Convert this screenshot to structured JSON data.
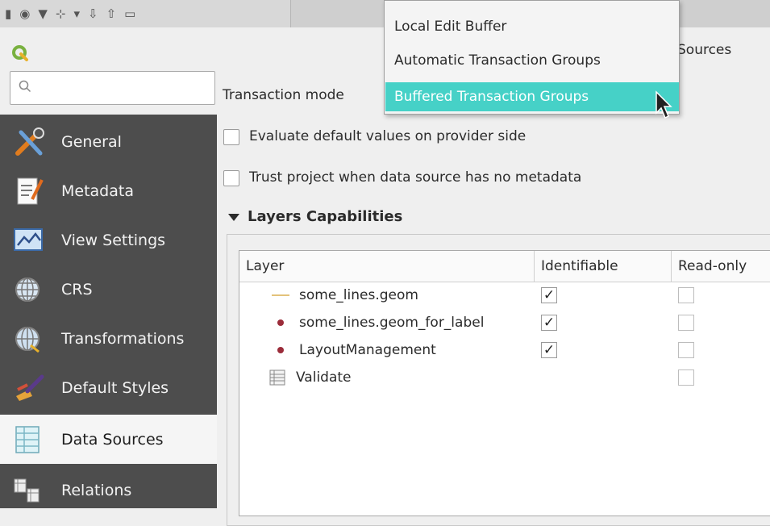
{
  "dialog": {
    "title_fragment": "Sources"
  },
  "search": {
    "placeholder": ""
  },
  "sidebar": {
    "items": [
      {
        "label": "General",
        "icon": "tools-icon"
      },
      {
        "label": "Metadata",
        "icon": "document-edit-icon"
      },
      {
        "label": "View Settings",
        "icon": "map-view-icon"
      },
      {
        "label": "CRS",
        "icon": "globe-icon"
      },
      {
        "label": "Transformations",
        "icon": "globe-transform-icon"
      },
      {
        "label": "Default Styles",
        "icon": "paint-brush-icon"
      },
      {
        "label": "Data Sources",
        "icon": "table-icon",
        "active": true
      },
      {
        "label": "Relations",
        "icon": "relations-icon"
      }
    ]
  },
  "main": {
    "transaction_mode_label": "Transaction mode",
    "evaluate_defaults_label": "Evaluate default values on provider side",
    "trust_project_label": "Trust project when data source has no metadata",
    "layers_capabilities_title": "Layers Capabilities",
    "table": {
      "headers": [
        "Layer",
        "Identifiable",
        "Read-only"
      ],
      "rows": [
        {
          "name": "some_lines.geom",
          "type": "line",
          "identifiable": true,
          "readonly": false
        },
        {
          "name": "some_lines.geom_for_label",
          "type": "point",
          "identifiable": true,
          "readonly": false
        },
        {
          "name": "LayoutManagement",
          "type": "point",
          "identifiable": true,
          "readonly": false
        },
        {
          "name": "Validate",
          "type": "table",
          "identifiable": null,
          "readonly": false
        }
      ]
    }
  },
  "dropdown": {
    "options": [
      "Local Edit Buffer",
      "Automatic Transaction Groups",
      "Buffered Transaction Groups"
    ],
    "selected_index": 2
  },
  "colors": {
    "sidebar_bg": "#4d4d4d",
    "selection_bg": "#46d1c7",
    "line_layer": "#e3c27a",
    "point_layer": "#9b2c3a"
  },
  "glyphs": {
    "check": "✓"
  }
}
